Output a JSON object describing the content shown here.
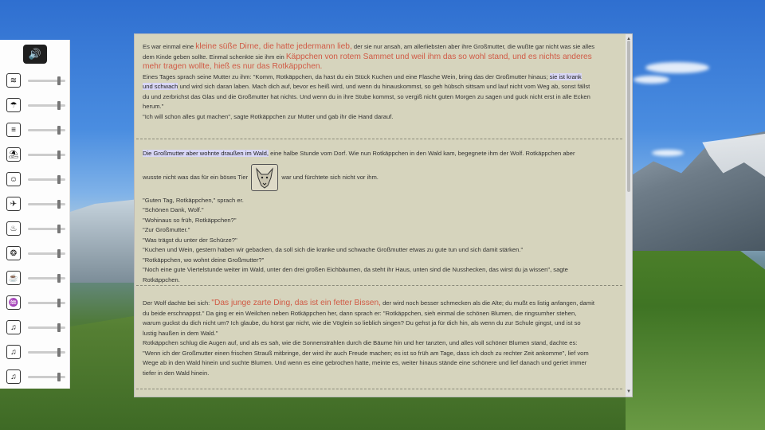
{
  "mixer": {
    "master_icon": "speaker-icon",
    "tracks": [
      {
        "icon": "wind-icon",
        "glyph": "≋",
        "level": 0.82
      },
      {
        "icon": "rain-cloud-icon",
        "glyph": "☂",
        "level": 0.82
      },
      {
        "icon": "waves-icon",
        "glyph": "≡",
        "level": 0.82
      },
      {
        "icon": "beach-umbrella-icon",
        "glyph": "⛱",
        "level": 0.82
      },
      {
        "icon": "people-icon",
        "glyph": "☺",
        "level": 0.82
      },
      {
        "icon": "bird-icon",
        "glyph": "✈",
        "level": 0.82
      },
      {
        "icon": "fire-icon",
        "glyph": "♨",
        "level": 0.82
      },
      {
        "icon": "flame-icon",
        "glyph": "❂",
        "level": 0.82
      },
      {
        "icon": "coffee-cup-icon",
        "glyph": "☕",
        "level": 0.82
      },
      {
        "icon": "lungs-icon",
        "glyph": "♒",
        "level": 0.82
      },
      {
        "icon": "music-note-icon",
        "glyph": "♫",
        "level": 0.82
      },
      {
        "icon": "music-note-icon",
        "glyph": "♫",
        "level": 0.82
      },
      {
        "icon": "music-note-icon",
        "glyph": "♫",
        "level": 0.82
      }
    ]
  },
  "story": {
    "p1": {
      "a": "Es war einmal eine ",
      "b": "kleine süße Dirne, die hatte jedermann lieb,",
      "c": " der sie nur ansah, am allerliebsten aber ihre Großmutter, die wußte gar nicht was sie alles",
      "d": "dem Kinde geben sollte. Einmal schenkte sie ihm ein ",
      "e": "Käppchen von rotem Sammet und weil ihm das so wohl stand, und es nichts anderes",
      "f": "mehr tragen wollte, hieß es nur das Rotkäppchen.",
      "g": "Eines Tages sprach seine Mutter zu ihm: \"Komm, Rotkäppchen, da hast du ein Stück Kuchen und eine Flasche Wein, bring das der Großmutter hinaus; ",
      "h": "sie ist krank",
      "i": "und schwach",
      "j": " und wird sich daran laben. Mach dich auf, bevor es heiß wird, und wenn du hinauskommst, so geh hübsch sittsam und lauf nicht vom Weg ab, sonst fällst",
      "k": "du und zerbrichst das Glas und die Großmutter hat nichts. Und wenn du in ihre Stube kommst, so vergiß nicht guten Morgen zu sagen und guck nicht erst in alle Ecken",
      "l": "herum.\"",
      "m": "\"Ich will schon alles gut machen\", sagte Rotkäppchen zur Mutter und gab ihr die Hand darauf."
    },
    "p2": {
      "a": "Die Großmutter aber wohnte draußen im Wald,",
      "b": " eine halbe Stunde vom Dorf. Wie nun Rotkäppchen in den Wald kam, begegnete ihm der Wolf. Rotkäppchen aber",
      "c": "wusste nicht was das für ein böses Tier",
      "d": "war und fürchtete sich nicht vor ihm.",
      "lines": [
        "\"Guten Tag, Rotkäppchen,\" sprach er.",
        "\"Schönen Dank, Wolf.\"",
        "\"Wohinaus so früh, Rotkäppchen?\"",
        "\"Zur Großmutter.\"",
        "\"Was trägst du unter der Schürze?\"",
        "\"Kuchen und Wein, gestern haben wir gebacken, da soll sich die kranke und schwache Großmutter etwas zu gute tun und sich damit stärken.\"",
        "\"Rotkäppchen, wo wohnt deine Großmutter?\"",
        "\"Noch eine gute Viertelstunde weiter im Wald, unter den drei großen Eichbäumen, da steht ihr Haus, unten sind die Nusshecken, das wirst du ja wissen\", sagte",
        "Rotkäppchen."
      ]
    },
    "p3": {
      "a": "Der Wolf dachte bei sich: ",
      "b": "\"Das junge zarte Ding, das ist ein fetter Bissen,",
      "c": " der wird noch besser schmecken als die Alte; du mußt es listig anfangen, damit",
      "lines": [
        "du beide erschnappst.\" Da ging er ein Weilchen neben Rotkäppchen her, dann sprach er: \"Rotkäppchen, sieh einmal die schönen Blumen, die ringsumher stehen,",
        "warum guckst du dich nicht um? Ich glaube, du hörst gar nicht, wie die Vöglein so lieblich singen? Du gehst ja für dich hin, als wenn du zur Schule gingst, und ist so",
        "lustig haußen in dem Wald.\"",
        "Rotkäppchen schlug die Augen auf, und als es sah, wie die Sonnenstrahlen durch die Bäume hin und her tanzten, und alles voll schöner Blumen stand, dachte es:",
        "\"Wenn ich der Großmutter einen frischen Strauß mitbringe, der wird ihr auch Freude machen; es ist so früh am Tage, dass ich doch zu rechter Zeit ankomme\", lief vom",
        "Wege ab in den Wald hinein und suchte Blumen. Und wenn es eine gebrochen hatte, meinte es, weiter hinaus stände eine schönere und lief danach und geriet immer",
        "tiefer in den Wald hinein."
      ]
    }
  },
  "colors": {
    "accent": "#d05a45",
    "highlight": "#d8d6f6",
    "panel": "#d6d4bd"
  }
}
